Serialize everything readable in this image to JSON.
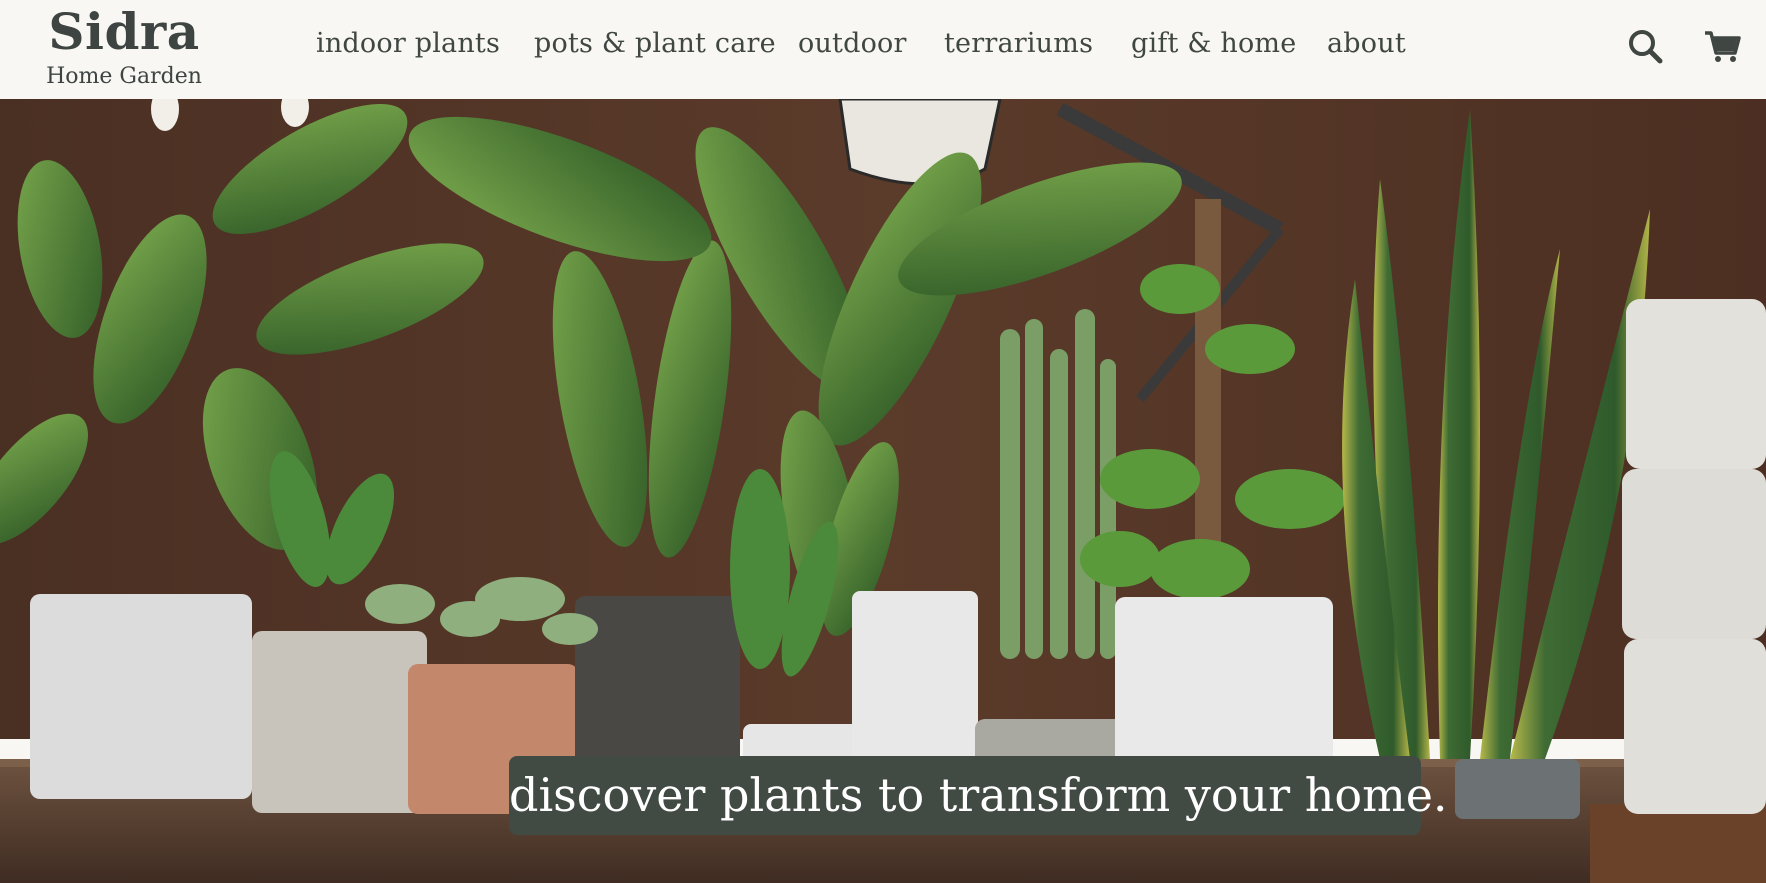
{
  "brand": {
    "name": "Sidra",
    "subtitle": "Home Garden"
  },
  "nav": {
    "items": [
      "indoor plants",
      "pots & plant care",
      "outdoor",
      "terrariums",
      "gift & home",
      "about"
    ]
  },
  "icons": {
    "search": "search-icon",
    "cart": "cart-icon"
  },
  "hero": {
    "tagline": "discover plants to transform your home."
  },
  "colors": {
    "header_bg": "#f8f7f3",
    "text": "#404743",
    "tagline_bg": "#424a44",
    "tagline_text": "#ffffff"
  }
}
